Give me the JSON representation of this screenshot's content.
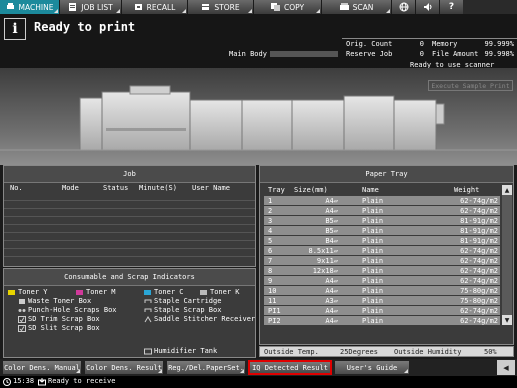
{
  "tabs": [
    {
      "label": "MACHINE",
      "icon": "printer-icon",
      "active": true
    },
    {
      "label": "JOB LIST",
      "icon": "list-icon",
      "active": false
    },
    {
      "label": "RECALL",
      "icon": "recall-icon",
      "active": false
    },
    {
      "label": "STORE",
      "icon": "store-icon",
      "active": false
    },
    {
      "label": "COPY",
      "icon": "copy-icon",
      "active": false
    },
    {
      "label": "SCAN",
      "icon": "scan-icon",
      "active": false
    }
  ],
  "header": {
    "info_icon": "i",
    "title": "Ready to print",
    "main_body_label": "Main Body",
    "orig_count_label": "Orig. Count",
    "orig_count_value": "0",
    "reserve_job_label": "Reserve Job",
    "reserve_job_value": "0",
    "memory_label": "Memory",
    "memory_value": "99.999%",
    "file_amount_label": "File Amount",
    "file_amount_value": "99.998%",
    "scanner_status": "Ready to use scanner",
    "execute_sample_label": "Execute Sample Print"
  },
  "job_panel": {
    "title": "Job",
    "headers": [
      "No.",
      "Mode",
      "Status",
      "Minute(S)",
      "User Name"
    ]
  },
  "consumables": {
    "title": "Consumable and Scrap Indicators",
    "items": [
      {
        "label": "Toner Y",
        "color": "#e8d400"
      },
      {
        "label": "Toner M",
        "color": "#d0399a"
      },
      {
        "label": "Toner C",
        "color": "#2aa6d6"
      },
      {
        "label": "Toner K",
        "color": "#222222"
      },
      {
        "label": "Waste Toner Box"
      },
      {
        "label": "Staple Cartridge"
      },
      {
        "label": "Punch-Hole Scraps Box"
      },
      {
        "label": "Staple Scrap Box"
      },
      {
        "label": "SD Trim Scrap Box"
      },
      {
        "label": "Saddle Stitcher Receiver"
      },
      {
        "label": "SD Slit Scrap Box"
      },
      {
        "label": "Humidifier Tank"
      }
    ]
  },
  "paper_tray": {
    "title": "Paper Tray",
    "headers": {
      "tray": "Tray",
      "size": "Size(mm)",
      "name": "Name",
      "weight": "Weight"
    },
    "rows": [
      {
        "tray": "1",
        "size": "A4▱",
        "name": "Plain",
        "weight": "62-74g/m2"
      },
      {
        "tray": "2",
        "size": "A4▱",
        "name": "Plain",
        "weight": "62-74g/m2"
      },
      {
        "tray": "3",
        "size": "B5▱",
        "name": "Plain",
        "weight": "81-91g/m2"
      },
      {
        "tray": "4",
        "size": "B5▱",
        "name": "Plain",
        "weight": "81-91g/m2"
      },
      {
        "tray": "5",
        "size": "B4▱",
        "name": "Plain",
        "weight": "81-91g/m2"
      },
      {
        "tray": "6",
        "size": "8.5x11▱",
        "name": "Plain",
        "weight": "62-74g/m2"
      },
      {
        "tray": "7",
        "size": "9x11▱",
        "name": "Plain",
        "weight": "62-74g/m2"
      },
      {
        "tray": "8",
        "size": "12x18▱",
        "name": "Plain",
        "weight": "62-74g/m2"
      },
      {
        "tray": "9",
        "size": "A4▱",
        "name": "Plain",
        "weight": "62-74g/m2"
      },
      {
        "tray": "10",
        "size": "A4▱",
        "name": "Plain",
        "weight": "75-80g/m2"
      },
      {
        "tray": "11",
        "size": "A3▱",
        "name": "Plain",
        "weight": "75-80g/m2"
      },
      {
        "tray": "PI1",
        "size": "A4▱",
        "name": "Plain",
        "weight": "62-74g/m2"
      },
      {
        "tray": "PI2",
        "size": "A4▱",
        "name": "Plain",
        "weight": "62-74g/m2"
      }
    ],
    "outside_temp_label": "Outside Temp.",
    "outside_temp_value": "25Degrees",
    "outside_humidity_label": "Outside Humidity",
    "outside_humidity_value": "50%"
  },
  "bottom_buttons": [
    {
      "label": "Color Dens. Manual"
    },
    {
      "label": "Color Dens. Result"
    },
    {
      "label": "Reg./Del.PaperSet."
    },
    {
      "label": "IQ Detected Result",
      "selected": true
    },
    {
      "label": "User's Guide"
    }
  ],
  "statusbar": {
    "time": "15:38",
    "message": "Ready to receive"
  }
}
